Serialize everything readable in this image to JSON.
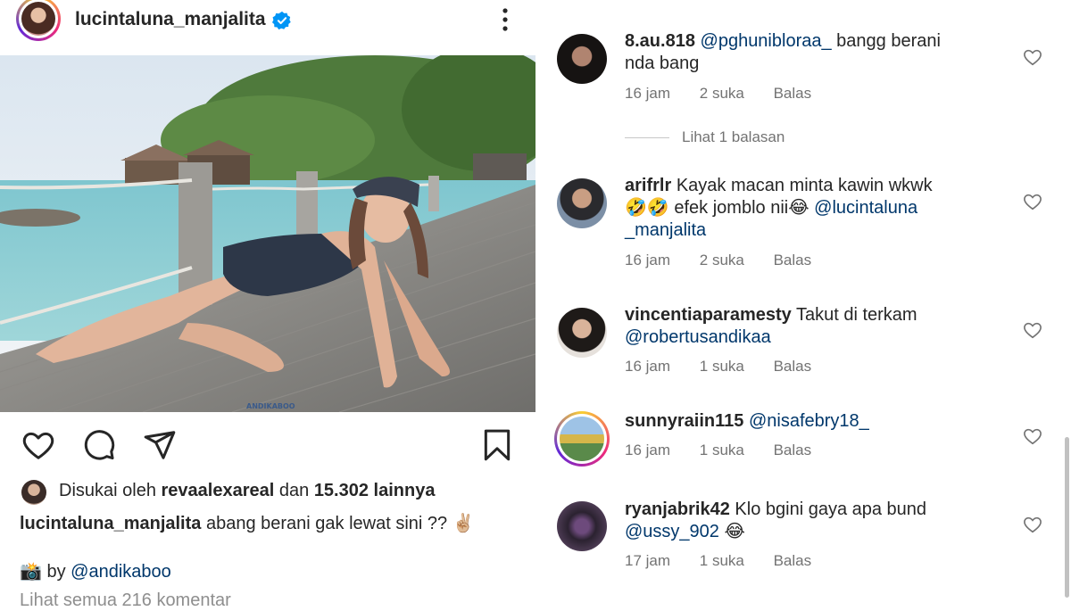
{
  "post": {
    "username": "lucintaluna_manjalita",
    "likes_prefix": "Disukai oleh",
    "liked_by": "revaalexareal",
    "likes_conj": "dan",
    "likes_count": "15.302 lainnya",
    "caption_user": "lucintaluna_manjalita",
    "caption_text": "abang berani gak lewat sini ?? ✌🏼",
    "credit_prefix": "📸 by",
    "credit_mention": "@andikaboo",
    "view_all_comments": "Lihat semua 216 komentar",
    "watermark": "ANDIKABOO"
  },
  "comments": [
    {
      "user": "8.au.818",
      "mention": "@pghunibloraa_",
      "text_line1": "bangg berani",
      "text_line2": "nda bang",
      "time": "16 jam",
      "likes": "2 suka",
      "reply": "Balas"
    },
    {
      "user": "arifrlr",
      "text_line1": "Kayak macan minta kawin wkwk",
      "text_line2_plain": "🤣🤣 efek jomblo nii😂",
      "mention_a": "@lucintaluna",
      "mention_b": "_manjalita",
      "time": "16 jam",
      "likes": "2 suka",
      "reply": "Balas"
    },
    {
      "user": "vincentiaparamesty",
      "text_line1": "Takut di terkam",
      "mention": "@robertusandikaa",
      "time": "16 jam",
      "likes": "1 suka",
      "reply": "Balas"
    },
    {
      "user": "sunnyraiin115",
      "mention": "@nisafebry18_",
      "time": "16 jam",
      "likes": "1 suka",
      "reply": "Balas"
    },
    {
      "user": "ryanjabrik42",
      "text_line1": "Klo bgini gaya apa bund",
      "mention": "@ussy_902",
      "emoji": "😂",
      "time": "17 jam",
      "likes": "1 suka",
      "reply": "Balas"
    }
  ],
  "view_replies": "Lihat 1 balasan",
  "icons": {
    "verified": "verified-badge-icon",
    "more": "more-options-icon",
    "like": "heart-icon",
    "comment": "comment-icon",
    "share": "share-icon",
    "save": "bookmark-icon"
  },
  "colors": {
    "verified": "#0095f6",
    "link": "#00376b",
    "meta": "#737373"
  }
}
